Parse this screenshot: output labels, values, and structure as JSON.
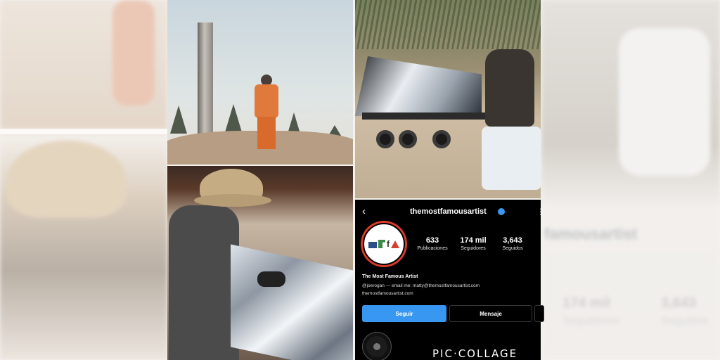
{
  "instagram": {
    "handle": "themostfamousartist",
    "back_icon": "‹",
    "stats": [
      {
        "number": "633",
        "label": "Publicaciones"
      },
      {
        "number": "174 mil",
        "label": "Seguidores"
      },
      {
        "number": "3,643",
        "label": "Seguidos"
      }
    ],
    "name": "The Most Famous Artist",
    "bio": "@joerogan — email me: matty@themostfamousartist.com",
    "link": "themostfamousartist.com",
    "follow_label": "Seguir",
    "message_label": "Mensaje",
    "logo_f": "f"
  },
  "watermark": "PIC·COLLAGE",
  "background": {
    "handle_fragment": "famousartist",
    "stat1_number": "174 mil",
    "stat1_label": "Seguidores",
    "stat2_number": "3,643",
    "stat2_label": "Seguidos"
  },
  "colors": {
    "follow_button": "#3897f0",
    "verified": "#3897f0",
    "logo_red": "#d6402e",
    "logo_blue": "#2c4f8a",
    "logo_green": "#3c8a46"
  }
}
